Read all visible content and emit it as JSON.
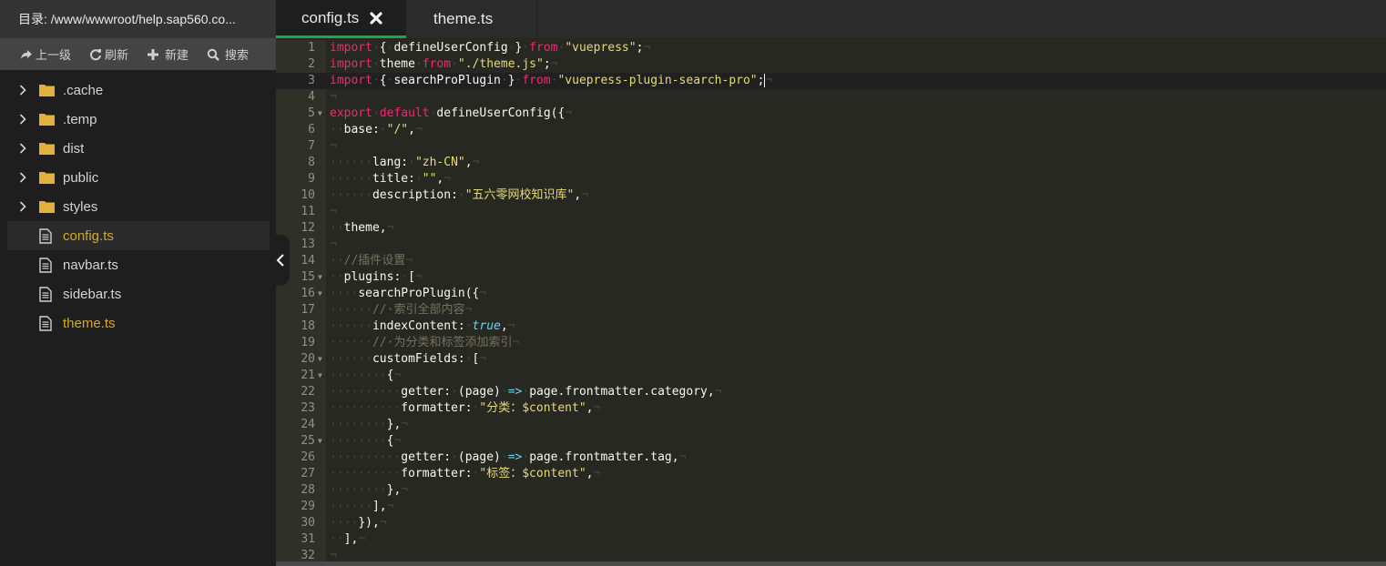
{
  "sidebar": {
    "path_label": "目录: /www/wwwroot/help.sap560.co...",
    "toolbar": [
      {
        "label": "上一级",
        "icon": "share-arrow-icon"
      },
      {
        "label": "刷新",
        "icon": "refresh-icon"
      },
      {
        "label": "新建",
        "icon": "plus-icon"
      },
      {
        "label": "搜索",
        "icon": "search-icon"
      }
    ],
    "tree": [
      {
        "name": ".cache",
        "type": "folder"
      },
      {
        "name": ".temp",
        "type": "folder"
      },
      {
        "name": "dist",
        "type": "folder"
      },
      {
        "name": "public",
        "type": "folder"
      },
      {
        "name": "styles",
        "type": "folder"
      },
      {
        "name": "config.ts",
        "type": "file",
        "open": true,
        "selected": true
      },
      {
        "name": "navbar.ts",
        "type": "file"
      },
      {
        "name": "sidebar.ts",
        "type": "file"
      },
      {
        "name": "theme.ts",
        "type": "file",
        "open": true
      }
    ]
  },
  "colors": {
    "accent_tab": "#1aa84a",
    "open_file": "#d4aa2a",
    "folder": "#e2b13c",
    "keyword": "#f92672",
    "string": "#e6db74",
    "comment": "#75715e",
    "constant": "#66d9ef"
  },
  "tabs": [
    {
      "label": "config.ts",
      "active": true,
      "closable": true
    },
    {
      "label": "theme.ts",
      "active": false
    }
  ],
  "editor": {
    "cursor_line": 3,
    "lines": [
      {
        "n": 1,
        "fold": false,
        "segs": [
          [
            "k",
            "import"
          ],
          [
            "ws",
            "·"
          ],
          [
            "t",
            "{"
          ],
          [
            "ws",
            "·"
          ],
          [
            "t",
            "defineUserConfig"
          ],
          [
            "ws",
            "·"
          ],
          [
            "t",
            "}"
          ],
          [
            "ws",
            "·"
          ],
          [
            "k",
            "from"
          ],
          [
            "ws",
            "·"
          ],
          [
            "s",
            "\"vuepress\""
          ],
          [
            "t",
            ";"
          ],
          [
            "ws",
            "¬"
          ]
        ]
      },
      {
        "n": 2,
        "fold": false,
        "segs": [
          [
            "k",
            "import"
          ],
          [
            "ws",
            "·"
          ],
          [
            "t",
            "theme"
          ],
          [
            "ws",
            "·"
          ],
          [
            "k",
            "from"
          ],
          [
            "ws",
            "·"
          ],
          [
            "s",
            "\"./theme.js\""
          ],
          [
            "t",
            ";"
          ],
          [
            "ws",
            "¬"
          ]
        ]
      },
      {
        "n": 3,
        "fold": false,
        "segs": [
          [
            "k",
            "import"
          ],
          [
            "ws",
            "·"
          ],
          [
            "t",
            "{"
          ],
          [
            "ws",
            "·"
          ],
          [
            "t",
            "searchProPlugin"
          ],
          [
            "ws",
            "·"
          ],
          [
            "t",
            "}"
          ],
          [
            "ws",
            "·"
          ],
          [
            "k",
            "from"
          ],
          [
            "ws",
            "·"
          ],
          [
            "s",
            "\"vuepress-plugin-search-pro\""
          ],
          [
            "t",
            ";"
          ],
          [
            "cursor",
            ""
          ],
          [
            "ws",
            "¬"
          ]
        ]
      },
      {
        "n": 4,
        "fold": false,
        "segs": [
          [
            "ws",
            "¬"
          ]
        ]
      },
      {
        "n": 5,
        "fold": true,
        "segs": [
          [
            "k",
            "export"
          ],
          [
            "ws",
            "·"
          ],
          [
            "k",
            "default"
          ],
          [
            "ws",
            "·"
          ],
          [
            "t",
            "defineUserConfig({"
          ],
          [
            "ws",
            "¬"
          ]
        ]
      },
      {
        "n": 6,
        "fold": false,
        "segs": [
          [
            "ws",
            "··"
          ],
          [
            "t",
            "base:"
          ],
          [
            "ws",
            "·"
          ],
          [
            "s",
            "\"/\""
          ],
          [
            "t",
            ","
          ],
          [
            "ws",
            "¬"
          ]
        ]
      },
      {
        "n": 7,
        "fold": false,
        "segs": [
          [
            "ws",
            "¬"
          ]
        ]
      },
      {
        "n": 8,
        "fold": false,
        "segs": [
          [
            "ws",
            "······"
          ],
          [
            "t",
            "lang:"
          ],
          [
            "ws",
            "·"
          ],
          [
            "s",
            "\"zh-CN\""
          ],
          [
            "t",
            ","
          ],
          [
            "ws",
            "¬"
          ]
        ]
      },
      {
        "n": 9,
        "fold": false,
        "segs": [
          [
            "ws",
            "······"
          ],
          [
            "t",
            "title:"
          ],
          [
            "ws",
            "·"
          ],
          [
            "s",
            "\"\""
          ],
          [
            "t",
            ","
          ],
          [
            "ws",
            "¬"
          ]
        ]
      },
      {
        "n": 10,
        "fold": false,
        "segs": [
          [
            "ws",
            "······"
          ],
          [
            "t",
            "description:"
          ],
          [
            "ws",
            "·"
          ],
          [
            "s",
            "\"五六零网校知识库\""
          ],
          [
            "t",
            ","
          ],
          [
            "ws",
            "¬"
          ]
        ]
      },
      {
        "n": 11,
        "fold": false,
        "segs": [
          [
            "ws",
            "¬"
          ]
        ]
      },
      {
        "n": 12,
        "fold": false,
        "segs": [
          [
            "ws",
            "··"
          ],
          [
            "t",
            "theme,"
          ],
          [
            "ws",
            "¬"
          ]
        ]
      },
      {
        "n": 13,
        "fold": false,
        "segs": [
          [
            "ws",
            "¬"
          ]
        ]
      },
      {
        "n": 14,
        "fold": false,
        "segs": [
          [
            "ws",
            "··"
          ],
          [
            "c",
            "//插件设置"
          ],
          [
            "ws",
            "¬"
          ]
        ]
      },
      {
        "n": 15,
        "fold": true,
        "segs": [
          [
            "ws",
            "··"
          ],
          [
            "t",
            "plugins:"
          ],
          [
            "ws",
            "·"
          ],
          [
            "t",
            "["
          ],
          [
            "ws",
            "¬"
          ]
        ]
      },
      {
        "n": 16,
        "fold": true,
        "segs": [
          [
            "ws",
            "····"
          ],
          [
            "t",
            "searchProPlugin({"
          ],
          [
            "ws",
            "¬"
          ]
        ]
      },
      {
        "n": 17,
        "fold": false,
        "segs": [
          [
            "ws",
            "······"
          ],
          [
            "c",
            "//·索引全部内容"
          ],
          [
            "ws",
            "¬"
          ]
        ]
      },
      {
        "n": 18,
        "fold": false,
        "segs": [
          [
            "ws",
            "······"
          ],
          [
            "t",
            "indexContent:"
          ],
          [
            "ws",
            "·"
          ],
          [
            "b",
            "true"
          ],
          [
            "t",
            ","
          ],
          [
            "ws",
            "¬"
          ]
        ]
      },
      {
        "n": 19,
        "fold": false,
        "segs": [
          [
            "ws",
            "······"
          ],
          [
            "c",
            "//·为分类和标签添加索引"
          ],
          [
            "ws",
            "¬"
          ]
        ]
      },
      {
        "n": 20,
        "fold": true,
        "segs": [
          [
            "ws",
            "······"
          ],
          [
            "t",
            "customFields:"
          ],
          [
            "ws",
            "·"
          ],
          [
            "t",
            "["
          ],
          [
            "ws",
            "¬"
          ]
        ]
      },
      {
        "n": 21,
        "fold": true,
        "segs": [
          [
            "ws",
            "········"
          ],
          [
            "t",
            "{"
          ],
          [
            "ws",
            "¬"
          ]
        ]
      },
      {
        "n": 22,
        "fold": false,
        "segs": [
          [
            "ws",
            "··········"
          ],
          [
            "t",
            "getter:"
          ],
          [
            "ws",
            "·"
          ],
          [
            "t",
            "(page)"
          ],
          [
            "ws",
            "·"
          ],
          [
            "o",
            "=>"
          ],
          [
            "ws",
            "·"
          ],
          [
            "t",
            "page.frontmatter.category,"
          ],
          [
            "ws",
            "¬"
          ]
        ]
      },
      {
        "n": 23,
        "fold": false,
        "segs": [
          [
            "ws",
            "··········"
          ],
          [
            "t",
            "formatter:"
          ],
          [
            "ws",
            "·"
          ],
          [
            "s",
            "\"分类：$content\""
          ],
          [
            "t",
            ","
          ],
          [
            "ws",
            "¬"
          ]
        ]
      },
      {
        "n": 24,
        "fold": false,
        "segs": [
          [
            "ws",
            "········"
          ],
          [
            "t",
            "},"
          ],
          [
            "ws",
            "¬"
          ]
        ]
      },
      {
        "n": 25,
        "fold": true,
        "segs": [
          [
            "ws",
            "········"
          ],
          [
            "t",
            "{"
          ],
          [
            "ws",
            "¬"
          ]
        ]
      },
      {
        "n": 26,
        "fold": false,
        "segs": [
          [
            "ws",
            "··········"
          ],
          [
            "t",
            "getter:"
          ],
          [
            "ws",
            "·"
          ],
          [
            "t",
            "(page)"
          ],
          [
            "ws",
            "·"
          ],
          [
            "o",
            "=>"
          ],
          [
            "ws",
            "·"
          ],
          [
            "t",
            "page.frontmatter.tag,"
          ],
          [
            "ws",
            "¬"
          ]
        ]
      },
      {
        "n": 27,
        "fold": false,
        "segs": [
          [
            "ws",
            "··········"
          ],
          [
            "t",
            "formatter:"
          ],
          [
            "ws",
            "·"
          ],
          [
            "s",
            "\"标签：$content\""
          ],
          [
            "t",
            ","
          ],
          [
            "ws",
            "¬"
          ]
        ]
      },
      {
        "n": 28,
        "fold": false,
        "segs": [
          [
            "ws",
            "········"
          ],
          [
            "t",
            "},"
          ],
          [
            "ws",
            "¬"
          ]
        ]
      },
      {
        "n": 29,
        "fold": false,
        "segs": [
          [
            "ws",
            "······"
          ],
          [
            "t",
            "],"
          ],
          [
            "ws",
            "¬"
          ]
        ]
      },
      {
        "n": 30,
        "fold": false,
        "segs": [
          [
            "ws",
            "····"
          ],
          [
            "t",
            "}),"
          ],
          [
            "ws",
            "¬"
          ]
        ]
      },
      {
        "n": 31,
        "fold": false,
        "segs": [
          [
            "ws",
            "··"
          ],
          [
            "t",
            "],"
          ],
          [
            "ws",
            "¬"
          ]
        ]
      },
      {
        "n": 32,
        "fold": false,
        "segs": [
          [
            "ws",
            "¬"
          ]
        ]
      }
    ]
  }
}
